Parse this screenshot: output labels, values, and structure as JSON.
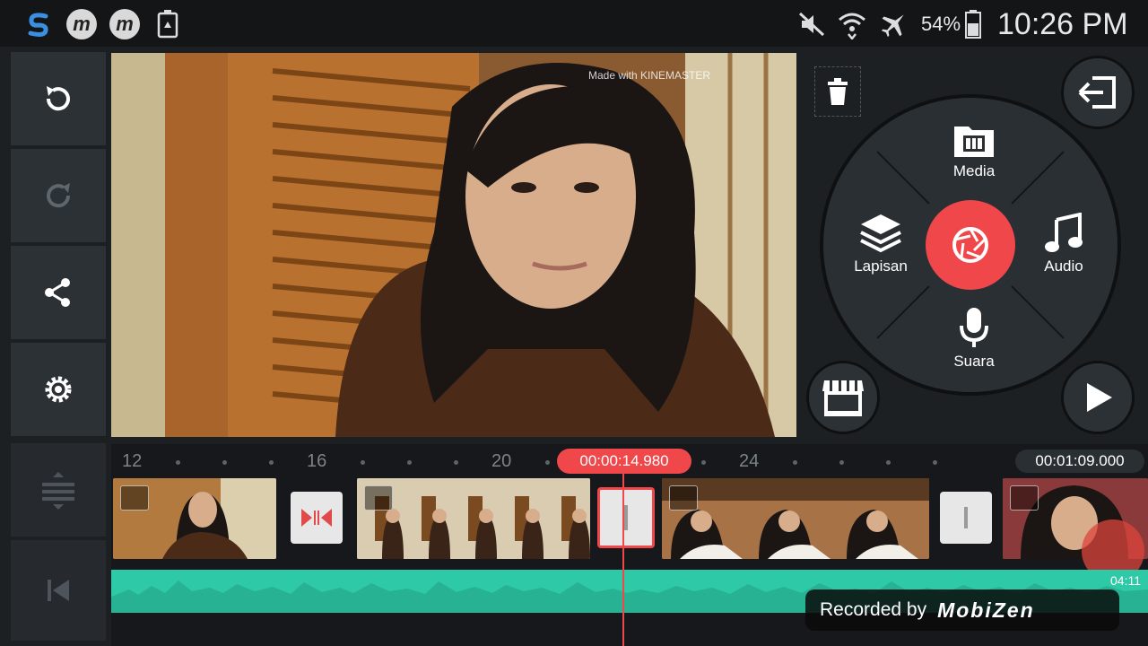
{
  "status_bar": {
    "battery_percent": "54%",
    "time": "10:26 PM",
    "left_icons": [
      "s-app-icon",
      "mobizen-icon",
      "mobizen-icon",
      "recycle-battery-icon"
    ],
    "right_icons": [
      "mute-icon",
      "wifi-icon",
      "airplane-icon",
      "battery-icon"
    ]
  },
  "watermark": "Made with KINEMASTER",
  "menu": {
    "media": "Media",
    "layer": "Lapisan",
    "audio": "Audio",
    "voice": "Suara"
  },
  "timeline": {
    "ruler": [
      "12",
      "16",
      "20",
      "24"
    ],
    "playhead_time": "00:00:14.980",
    "total_time": "00:01:09.000",
    "clip_duration": "04:11"
  },
  "overlay": {
    "recorded_by": "Recorded by",
    "brand": "MobiZen"
  },
  "colors": {
    "accent_red": "#f0474a",
    "audio_teal": "#2ec9a7",
    "toolbar_bg": "#2c3136"
  }
}
